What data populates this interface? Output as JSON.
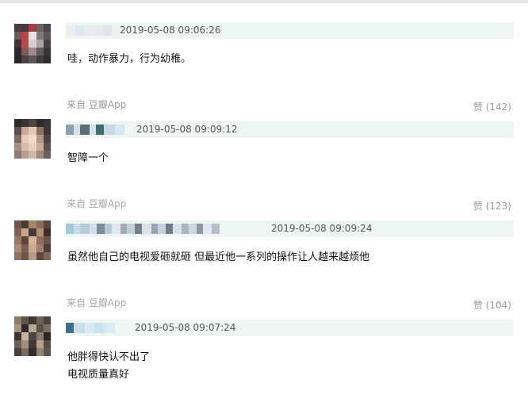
{
  "comments": [
    {
      "time": "2019-05-08 09:06:26",
      "lines": [
        "哇，动作暴力，行为幼稚。"
      ],
      "source": "来自 豆瓣App",
      "vote": "赞 (142)",
      "name_colors": [
        "#eceff1",
        "#dde6f1",
        "#e8eaee",
        "#e3eaf0",
        "#dfe4e8",
        "#eef0f2"
      ]
    },
    {
      "time": "2019-05-08 09:09:12",
      "lines": [
        "智障一个"
      ],
      "source": "来自 豆瓣App",
      "vote": "赞 (123)",
      "name_colors": [
        "#8aa1b1",
        "#d4dfe6",
        "#5b6f78",
        "#d6e3ea",
        "#3e6e6a",
        "#c7d9e3",
        "#d6e8f1"
      ]
    },
    {
      "time": "2019-05-08 09:09:24",
      "lines": [
        "虽然他自己的电视爱砸就砸 但最近他一系列的操作让人越来越烦他"
      ],
      "source": "来自 豆瓣App",
      "vote": "赞 (104)",
      "name_colors": [
        "#a8c9d9",
        "#c9dbe6",
        "#b7ccd8",
        "#d0dfe8",
        "#7c8a99",
        "#b6c8d4",
        "#dfe9ef",
        "#a2aab4",
        "#c1cfd8",
        "#7a7f87",
        "#d7e2e9",
        "#9aa6b1",
        "#c5d3dc",
        "#6f7a84",
        "#d9e4ea",
        "#a9b5bf",
        "#cbd8e0",
        "#8d98a2",
        "#e0e8ee",
        "#b4c1cb"
      ]
    },
    {
      "time": "2019-05-08 09:07:24",
      "lines": [
        "他胖得快认不出了",
        "电视质量真好"
      ],
      "name_colors": [
        "#3f6f8e",
        "#c8def0",
        "#dbe9f5",
        "#c7e2f0",
        "#d9ecf4"
      ]
    }
  ],
  "avatar_colors": [
    [
      "#4b3b3a",
      "#3d3a44",
      "#a33b44",
      "#6c6260",
      "#4a4550",
      "#6a5a5a",
      "#c53f45",
      "#e6e2df",
      "#7f7a78",
      "#5d5658",
      "#3e3638",
      "#b84a46",
      "#d6cfcd",
      "#a9a2a3",
      "#454047",
      "#2f2a2e",
      "#7d5a55",
      "#9b8d8b",
      "#605a5f",
      "#3a3439",
      "#2a2629",
      "#4b4145",
      "#5d5457",
      "#3f383d",
      "#2e2a2d"
    ],
    [
      "#2f2b2a",
      "#3b3331",
      "#4e4542",
      "#2d2a2b",
      "#3a3535",
      "#5a4f4c",
      "#c9a998",
      "#e3c8b7",
      "#8a7468",
      "#3d3634",
      "#7c6a61",
      "#e6cbb7",
      "#f0dccd",
      "#b39686",
      "#4d4440",
      "#a68f82",
      "#d9bda9",
      "#e7cfbd",
      "#c7ab98",
      "#5a4f4a",
      "#8a7b73",
      "#b5a093",
      "#cfb8a8",
      "#9c8a7f",
      "#6b5f59"
    ],
    [
      "#6d5448",
      "#4b3a33",
      "#a5856e",
      "#8a6d5b",
      "#5a463d",
      "#7e6252",
      "#c8a68c",
      "#4a3931",
      "#b08f76",
      "#3c2f29",
      "#9b7a64",
      "#5c4639",
      "#d4b49a",
      "#8e705c",
      "#6b5445",
      "#a78b75",
      "#7a5f4f",
      "#c6aa92",
      "#9c806c",
      "#4d3d34",
      "#8c7361",
      "#6e5748",
      "#b59a84",
      "#5e4a3e",
      "#7f6757"
    ],
    [
      "#8b7b6a",
      "#5e5448",
      "#3d3631",
      "#6f6357",
      "#4a423b",
      "#a29280",
      "#2f2a27",
      "#b8a893",
      "#5a5046",
      "#7d6f61",
      "#3b342f",
      "#c5b5a0",
      "#4e463e",
      "#8a7c6d",
      "#2c2724",
      "#6b6055",
      "#9e8f7e",
      "#3f3833",
      "#b1a18e",
      "#564c43",
      "#494039",
      "#7a6d5f",
      "#332d29",
      "#928473",
      "#5f554b"
    ]
  ]
}
